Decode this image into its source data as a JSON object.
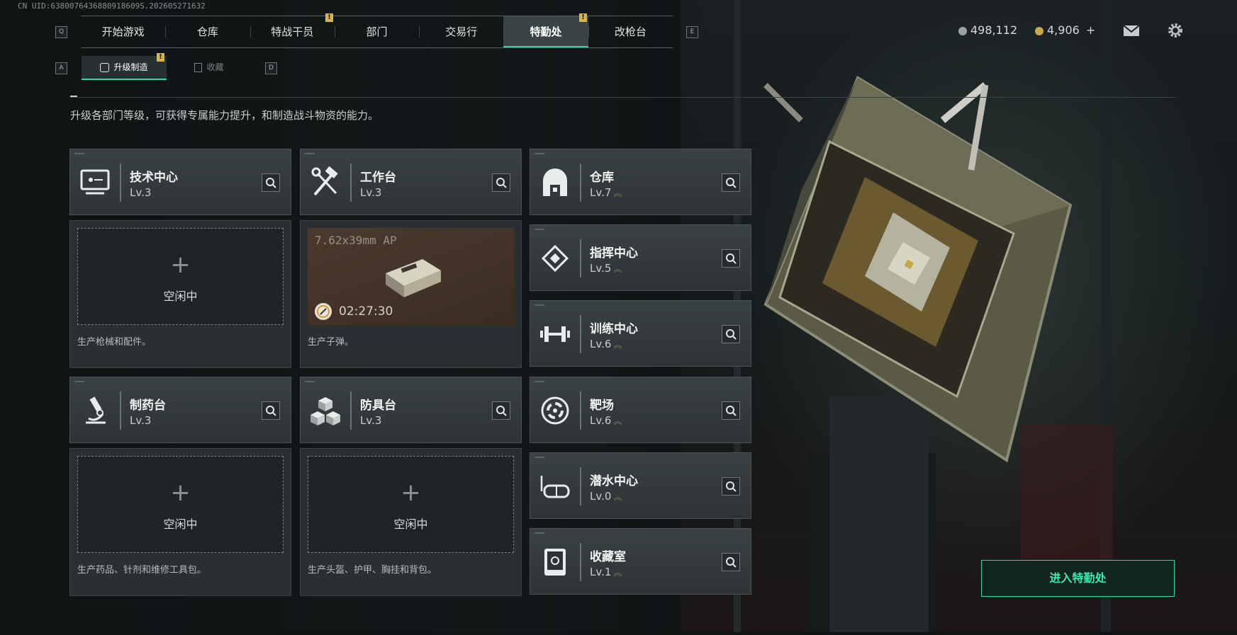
{
  "uid": "CN UID:6380076436880918609S.202605271632",
  "currency": {
    "silver": "498,112",
    "gold": "4,906",
    "gold_add": "+"
  },
  "keys": {
    "left_top": "Q",
    "right_top": "E",
    "left_sub": "A",
    "right_sub": "D"
  },
  "tabs": [
    {
      "label": "开始游戏",
      "active": false,
      "badge": ""
    },
    {
      "label": "仓库",
      "active": false,
      "badge": ""
    },
    {
      "label": "特战干员",
      "active": false,
      "badge": "!"
    },
    {
      "label": "部门",
      "active": false,
      "badge": ""
    },
    {
      "label": "交易行",
      "active": false,
      "badge": ""
    },
    {
      "label": "特勤处",
      "active": true,
      "badge": "!"
    },
    {
      "label": "改枪台",
      "active": false,
      "badge": ""
    }
  ],
  "subtabs": [
    {
      "label": "升级制造",
      "active": true,
      "badge": "!"
    },
    {
      "label": "收藏",
      "active": false
    }
  ],
  "description": "升级各部门等级，可获得专属能力提升，和制造战斗物资的能力。",
  "stations": [
    {
      "name": "技术中心",
      "level": "Lv.3",
      "icon": "monitor-icon",
      "slot": {
        "state": "idle",
        "plus": "+",
        "label": "空闲中"
      },
      "desc": "生产枪械和配件。"
    },
    {
      "name": "工作台",
      "level": "Lv.3",
      "icon": "hammer-wrench-icon",
      "slot": {
        "state": "producing",
        "item": "7.62x39mm AP",
        "timer": "02:27:30"
      },
      "desc": "生产子弹。"
    },
    {
      "name": "制药台",
      "level": "Lv.3",
      "icon": "microscope-icon",
      "slot": {
        "state": "idle",
        "plus": "+",
        "label": "空闲中"
      },
      "desc": "生产药品、针剂和维修工具包。"
    },
    {
      "name": "防具台",
      "level": "Lv.3",
      "icon": "cubes-icon",
      "slot": {
        "state": "idle",
        "plus": "+",
        "label": "空闲中"
      },
      "desc": "生产头盔、护甲、胸挂和背包。"
    }
  ],
  "departments": [
    {
      "name": "仓库",
      "level": "Lv.7",
      "icon": "vault-icon"
    },
    {
      "name": "指挥中心",
      "level": "Lv.5",
      "icon": "command-icon"
    },
    {
      "name": "训练中心",
      "level": "Lv.6",
      "icon": "dumbbell-icon"
    },
    {
      "name": "靶场",
      "level": "Lv.6",
      "icon": "target-icon"
    },
    {
      "name": "潜水中心",
      "level": "Lv.0",
      "icon": "dive-mask-icon"
    },
    {
      "name": "收藏室",
      "level": "Lv.1",
      "icon": "collection-icon"
    }
  ],
  "enter_button": "进入特勤处",
  "colors": {
    "accent": "#2fd8a0",
    "badge": "#d8b44a"
  }
}
